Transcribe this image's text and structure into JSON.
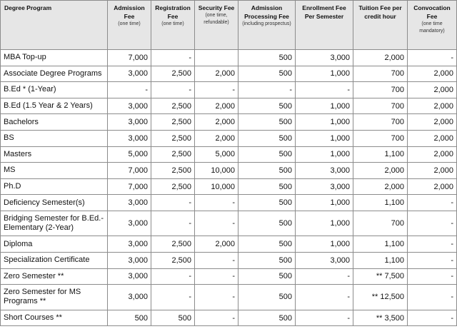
{
  "headers": [
    {
      "title": "Degree Program",
      "sub": ""
    },
    {
      "title": "Admission Fee",
      "sub": "(one time)"
    },
    {
      "title": "Registration Fee",
      "sub": "(one time)"
    },
    {
      "title": "Security Fee",
      "sub": "(one time, refundable)"
    },
    {
      "title": "Admission Processing Fee",
      "sub": "(including prospectus)"
    },
    {
      "title": "Enrollment Fee Per Semester",
      "sub": ""
    },
    {
      "title": "Tuition Fee per credit hour",
      "sub": ""
    },
    {
      "title": "Convocation Fee",
      "sub": "(one time mandatory)"
    }
  ],
  "rows": [
    [
      "MBA Top-up",
      "7,000",
      "-",
      "",
      "500",
      "3,000",
      "2,000",
      "-"
    ],
    [
      "Associate Degree Programs",
      "3,000",
      "2,500",
      "2,000",
      "500",
      "1,000",
      "700",
      "2,000"
    ],
    [
      "B.Ed * (1-Year)",
      "-",
      "-",
      "-",
      "-",
      "-",
      "700",
      "2,000"
    ],
    [
      "B.Ed (1.5 Year & 2 Years)",
      "3,000",
      "2,500",
      "2,000",
      "500",
      "1,000",
      "700",
      "2,000"
    ],
    [
      "Bachelors",
      "3,000",
      "2,500",
      "2,000",
      "500",
      "1,000",
      "700",
      "2,000"
    ],
    [
      "BS",
      "3,000",
      "2,500",
      "2,000",
      "500",
      "1,000",
      "700",
      "2,000"
    ],
    [
      "Masters",
      "5,000",
      "2,500",
      "5,000",
      "500",
      "1,000",
      "1,100",
      "2,000"
    ],
    [
      "MS",
      "7,000",
      "2,500",
      "10,000",
      "500",
      "3,000",
      "2,000",
      "2,000"
    ],
    [
      "Ph.D",
      "7,000",
      "2,500",
      "10,000",
      "500",
      "3,000",
      "2,000",
      "2,000"
    ],
    [
      "Deficiency Semester(s)",
      "3,000",
      "-",
      "-",
      "500",
      "1,000",
      "1,100",
      "-"
    ],
    [
      "Bridging Semester for B.Ed.-Elementary (2-Year)",
      "3,000",
      "-",
      "-",
      "500",
      "1,000",
      "700",
      "-"
    ],
    [
      "Diploma",
      "3,000",
      "2,500",
      "2,000",
      "500",
      "1,000",
      "1,100",
      "-"
    ],
    [
      "Specialization Certificate",
      "3,000",
      "2,500",
      "-",
      "500",
      "3,000",
      "1,100",
      "-"
    ],
    [
      "Zero Semester **",
      "3,000",
      "-",
      "-",
      "500",
      "-",
      "** 7,500",
      "-"
    ],
    [
      "Zero Semester for MS Programs **",
      "3,000",
      "-",
      "-",
      "500",
      "-",
      "** 12,500",
      "-"
    ],
    [
      "Short Courses **",
      "500",
      "500",
      "-",
      "500",
      "-",
      "** 3,500",
      "-"
    ]
  ],
  "tall_rows": [
    10,
    14
  ]
}
